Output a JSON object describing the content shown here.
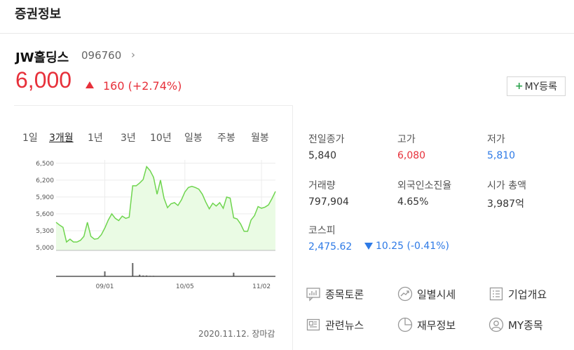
{
  "header": {
    "title": "증권정보"
  },
  "stock": {
    "name": "JW홀딩스",
    "code": "096760",
    "price": "6,000",
    "change": "160",
    "change_pct": "(+2.74%)",
    "my_button": "MY등록"
  },
  "tabs": [
    {
      "label": "1일",
      "active": false
    },
    {
      "label": "3개월",
      "active": true
    },
    {
      "label": "1년",
      "active": false
    },
    {
      "label": "3년",
      "active": false
    },
    {
      "label": "10년",
      "active": false
    },
    {
      "label": "일봉",
      "active": false
    },
    {
      "label": "주봉",
      "active": false
    },
    {
      "label": "월봉",
      "active": false
    }
  ],
  "chart_data": {
    "type": "area",
    "y_ticks": [
      "6,500",
      "6,200",
      "5,900",
      "5,600",
      "5,300",
      "5,000"
    ],
    "ylim": [
      4950,
      6560
    ],
    "x_ticks": [
      "09/01",
      "10/05",
      "11/02"
    ],
    "x_tick_index": [
      14,
      37,
      59
    ],
    "values": [
      5450,
      5400,
      5360,
      5100,
      5150,
      5100,
      5100,
      5130,
      5200,
      5450,
      5200,
      5150,
      5160,
      5230,
      5350,
      5490,
      5600,
      5520,
      5480,
      5560,
      5520,
      5540,
      6100,
      6100,
      6150,
      6210,
      6440,
      6370,
      6250,
      5950,
      6200,
      5880,
      5710,
      5780,
      5800,
      5750,
      5850,
      5990,
      6070,
      6090,
      6070,
      6040,
      5950,
      5810,
      5690,
      5790,
      5740,
      5800,
      5700,
      5900,
      5880,
      5530,
      5510,
      5420,
      5290,
      5290,
      5490,
      5570,
      5730,
      5700,
      5720,
      5760,
      5870,
      6000
    ],
    "volume": [
      0,
      0,
      0,
      0,
      0,
      0,
      0,
      0,
      0,
      0,
      0,
      0,
      0,
      0,
      3,
      0,
      0,
      0,
      0,
      0,
      0,
      0,
      8,
      0,
      1,
      0.5,
      0.5,
      0.3,
      0.3,
      0,
      0,
      0,
      0,
      0,
      0,
      0,
      0,
      0,
      0,
      0,
      0,
      0,
      0,
      0,
      0,
      0,
      0,
      0,
      0,
      0,
      0,
      2.2,
      0,
      0,
      0,
      0,
      0,
      0,
      0,
      0,
      0,
      0,
      0,
      0
    ]
  },
  "chart_date": "2020.11.12. 장마감",
  "stats": {
    "prev_close_label": "전일종가",
    "prev_close": "5,840",
    "high_label": "고가",
    "high": "6,080",
    "low_label": "저가",
    "low": "5,810",
    "volume_label": "거래량",
    "volume": "797,904",
    "foreign_label": "외국인소진율",
    "foreign": "4.65%",
    "mcap_label": "시가 총액",
    "mcap": "3,987억"
  },
  "kospi": {
    "label": "코스피",
    "value": "2,475.62",
    "change": "10.25 (-0.41%)"
  },
  "links": {
    "discussion": "종목토론",
    "daily_price": "일별시세",
    "company_info": "기업개요",
    "news": "관련뉴스",
    "financial": "재무정보",
    "my_stocks": "MY종목"
  },
  "colors": {
    "up": "#e7303a",
    "down": "#2e7ae6",
    "line": "#6fd54f",
    "area": "#eafbe4"
  }
}
